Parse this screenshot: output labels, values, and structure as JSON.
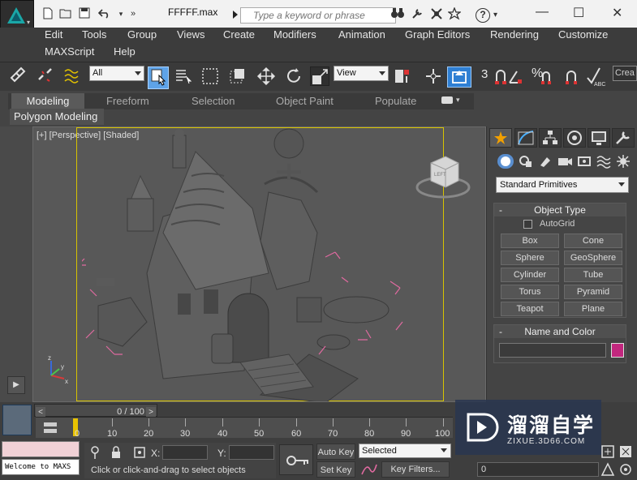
{
  "titlebar": {
    "file_title": "FFFFF.max",
    "search_placeholder": "Type a keyword or phrase",
    "help_label": "?"
  },
  "menu": {
    "row1": [
      "Edit",
      "Tools",
      "Group",
      "Views",
      "Create",
      "Modifiers",
      "Animation",
      "Graph Editors",
      "Rendering",
      "Customize"
    ],
    "row2": [
      "MAXScript",
      "Help"
    ]
  },
  "toolbar": {
    "selection_filter": "All",
    "ref_coord": "View",
    "angle_snap_label": "3",
    "percent_snap_label": "%",
    "named_sel_partial": "Crea",
    "spelling_label": "ABC"
  },
  "ribbon": {
    "tabs": [
      "Modeling",
      "Freeform",
      "Selection",
      "Object Paint",
      "Populate"
    ],
    "active_tab": "Modeling",
    "panel_label": "Polygon Modeling"
  },
  "viewport": {
    "label": "[+] [Perspective] [Shaded]",
    "viewcube_label": "LEFT",
    "axis_labels": {
      "x": "x",
      "y": "y",
      "z": "z"
    }
  },
  "command_panel": {
    "category": "Standard Primitives",
    "object_type_title": "Object Type",
    "autogrid_label": "AutoGrid",
    "primitives": [
      "Box",
      "Cone",
      "Sphere",
      "GeoSphere",
      "Cylinder",
      "Tube",
      "Torus",
      "Pyramid",
      "Teapot",
      "Plane"
    ],
    "name_color_title": "Name and Color",
    "object_color": "#c2277e"
  },
  "timeline": {
    "slider_text": "0 / 100",
    "tick_labels": [
      "0",
      "10",
      "20",
      "30",
      "40",
      "50",
      "60",
      "70",
      "80",
      "90",
      "100"
    ]
  },
  "statusbar": {
    "maxscript_text": "Welcome to MAXS",
    "prompt": "Click or click-and-drag to select objects",
    "x_label": "X:",
    "y_label": "Y:",
    "auto_key": "Auto Key",
    "set_key": "Set Key",
    "selected_option": "Selected",
    "key_filters": "Key Filters...",
    "frame_value": "0"
  },
  "watermark": {
    "brand": "溜溜自学",
    "url": "ZIXUE.3D66.COM"
  },
  "colors": {
    "accent_yellow": "#d8c400",
    "safe_frame": "#d8c400",
    "helper_pink": "#e06aa0"
  }
}
